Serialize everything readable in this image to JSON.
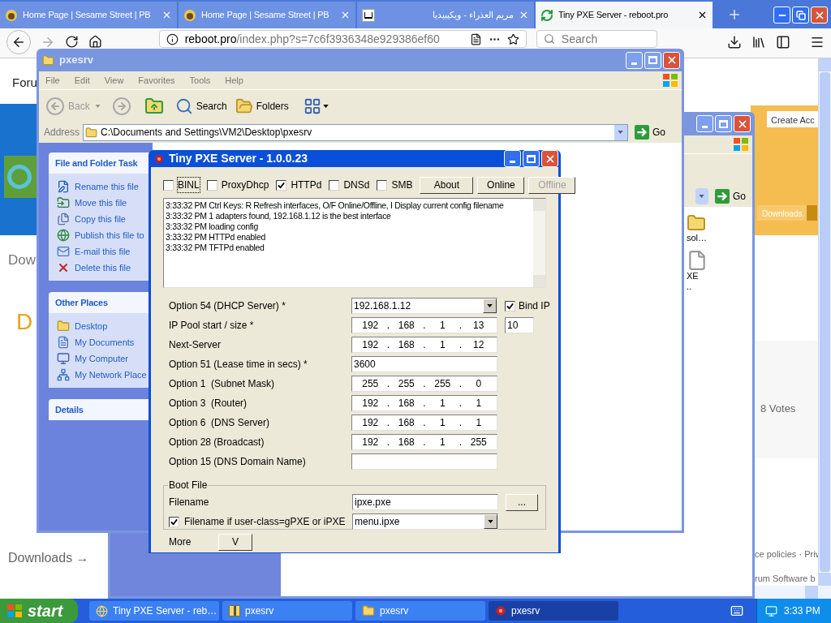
{
  "browser": {
    "tabs": [
      {
        "title": "Home Page | Sesame Street | PB",
        "selected": false
      },
      {
        "title": "Home Page | Sesame Street | PB",
        "selected": false
      },
      {
        "title": "مريم العذراء - ويكيبيديا",
        "selected": false
      },
      {
        "title": "Tiny PXE Server - reboot.pro",
        "selected": true
      }
    ],
    "url_host": "reboot.pro",
    "url_path": "/index.php?s=7c6f3936348e929386ef60",
    "search_placeholder": "Search",
    "page": {
      "nav_item": "Foru",
      "section_heading": "Dow",
      "title_letter": "D",
      "create_account": "Create Acc",
      "downloads_button": "Downloads",
      "votes": "8 Votes",
      "footer_links": "ce policies · Priv",
      "footer_credit": "rum Software b",
      "downloads_link": "Downloads →"
    }
  },
  "explorer_behind": {
    "go": "Go",
    "files": [
      {
        "kind": "folder",
        "lines": [
          "sol…"
        ]
      },
      {
        "kind": "file",
        "lines": [
          "XE",
          ".."
        ]
      }
    ]
  },
  "explorer": {
    "title": "pxesrv",
    "menu": [
      "File",
      "Edit",
      "View",
      "Favorites",
      "Tools",
      "Help"
    ],
    "toolbar": {
      "back": {
        "label": "Back",
        "disabled": true
      },
      "forward": {
        "disabled": true
      },
      "search": "Search",
      "folders": "Folders"
    },
    "address_label": "Address",
    "address": "C:\\Documents and Settings\\VM2\\Desktop\\pxesrv",
    "go": "Go",
    "panels": [
      {
        "title": "File and Folder Task",
        "items": [
          "Rename this file",
          "Move this file",
          "Copy this file",
          "Publish this file to",
          "E-mail this file",
          "Delete this file"
        ]
      },
      {
        "title": "Other Places",
        "items": [
          "Desktop",
          "My Documents",
          "My Computer",
          "My Network Place"
        ]
      },
      {
        "title": "Details"
      }
    ]
  },
  "pxe": {
    "title": "Tiny PXE Server - 1.0.0.23",
    "checkboxes": [
      {
        "label": "BINL",
        "checked": false,
        "focused": true
      },
      {
        "label": "ProxyDhcp",
        "checked": false,
        "focused": false
      },
      {
        "label": "HTTPd",
        "checked": true,
        "focused": false
      },
      {
        "label": "DNSd",
        "checked": false,
        "focused": false
      },
      {
        "label": "SMB",
        "checked": false,
        "focused": false
      }
    ],
    "buttons": [
      {
        "label": "About",
        "disabled": false
      },
      {
        "label": "Online",
        "disabled": false
      },
      {
        "label": "Offline",
        "disabled": true
      }
    ],
    "log": [
      "3:33:32 PM Ctrl Keys: R Refresh interfaces, O/F Online/Offline, I Display current config filename",
      "3:33:32 PM 1 adapters found, 192.168.1.12 is the best interface",
      "3:33:32 PM loading config",
      "3:33:32 PM HTTPd enabled",
      "3:33:32 PM TFTPd enabled"
    ],
    "fields": [
      {
        "kind": "combo",
        "label": "Option 54 (DHCP Server) *",
        "value": "192.168.1.12",
        "extra": {
          "kind": "checkbox",
          "label": "Bind IP",
          "checked": true
        }
      },
      {
        "kind": "ip",
        "label": "IP Pool start / size *",
        "parts": [
          "192",
          ".",
          "168",
          ".",
          "1",
          ".",
          "13"
        ],
        "extra": {
          "kind": "text",
          "value": "10"
        }
      },
      {
        "kind": "ip",
        "label": "Next-Server",
        "parts": [
          "192",
          ".",
          "168",
          ".",
          "1",
          ".",
          "12"
        ]
      },
      {
        "kind": "text",
        "label": "Option 51 (Lease time in secs) *",
        "value": "3600"
      },
      {
        "kind": "ip",
        "label": "Option 1  (Subnet Mask)",
        "parts": [
          "255",
          ".",
          "255",
          ".",
          "255",
          ".",
          "0"
        ]
      },
      {
        "kind": "ip",
        "label": "Option 3  (Router)",
        "parts": [
          "192",
          ".",
          "168",
          ".",
          "1",
          ".",
          "1"
        ]
      },
      {
        "kind": "ip",
        "label": "Option 6  (DNS Server)",
        "parts": [
          "192",
          ".",
          "168",
          ".",
          "1",
          ".",
          "1"
        ]
      },
      {
        "kind": "ip",
        "label": "Option 28 (Broadcast)",
        "parts": [
          "192",
          ".",
          "168",
          ".",
          "1",
          ".",
          "255"
        ]
      },
      {
        "kind": "text",
        "label": "Option 15 (DNS Domain Name)"
      }
    ],
    "boot_file": {
      "title": "Boot File",
      "filename_label": "Filename",
      "filename": "ipxe.pxe",
      "browse": "...",
      "user_class": {
        "label": "Filename if user-class=gPXE or iPXE",
        "checked": true,
        "value": "menu.ipxe"
      }
    },
    "more_label": "More",
    "more_button": "V"
  },
  "taskbar": {
    "start": "start",
    "items": [
      {
        "label": "Tiny PXE Server - reb…",
        "kind": "browser",
        "selected": false
      },
      {
        "label": "pxesrv",
        "kind": "archive",
        "selected": false
      },
      {
        "label": "pxesrv",
        "kind": "folder",
        "selected": false
      },
      {
        "label": "pxesrv",
        "kind": "app",
        "selected": true
      }
    ],
    "clock": "3:33 PM"
  }
}
